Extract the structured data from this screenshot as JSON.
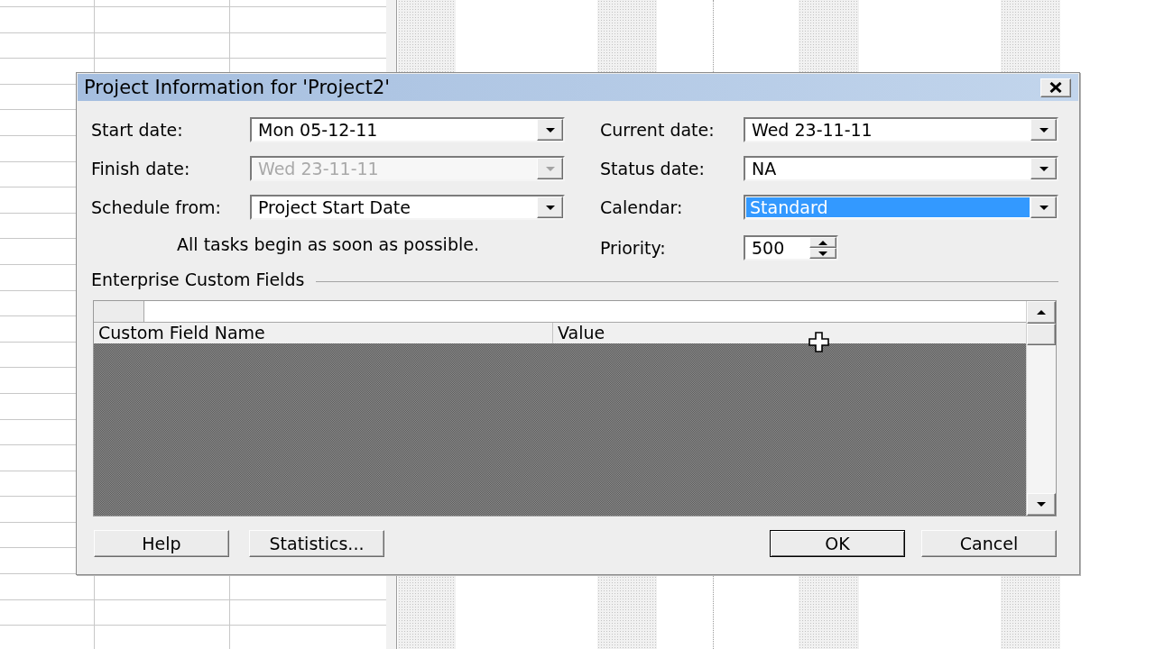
{
  "window": {
    "title": "Project Information for 'Project2'"
  },
  "left_fields": [
    {
      "label": "Start date:",
      "kind": "combo",
      "value": "Mon 05-12-11",
      "disabled": false,
      "highlighted": false
    },
    {
      "label": "Finish date:",
      "kind": "combo",
      "value": "Wed 23-11-11",
      "disabled": true,
      "highlighted": false
    },
    {
      "label": "Schedule from:",
      "kind": "combo",
      "value": "Project Start Date",
      "disabled": false,
      "highlighted": false
    }
  ],
  "schedule_note": "All tasks begin as soon as possible.",
  "right_fields": [
    {
      "label": "Current date:",
      "kind": "combo",
      "value": "Wed 23-11-11",
      "disabled": false,
      "highlighted": false
    },
    {
      "label": "Status date:",
      "kind": "combo",
      "value": "NA",
      "disabled": false,
      "highlighted": false
    },
    {
      "label": "Calendar:",
      "kind": "combo",
      "value": "Standard",
      "disabled": false,
      "highlighted": true
    },
    {
      "label": "Priority:",
      "kind": "spin",
      "value": "500",
      "disabled": false,
      "highlighted": false
    }
  ],
  "custom_fields": {
    "title": "Enterprise Custom Fields",
    "columns": [
      "Custom Field Name",
      "Value"
    ]
  },
  "left_buttons": [
    {
      "label": "Help",
      "default": false
    },
    {
      "label": "Statistics...",
      "default": false
    }
  ],
  "right_buttons": [
    {
      "label": "OK",
      "default": true
    },
    {
      "label": "Cancel",
      "default": false
    }
  ]
}
